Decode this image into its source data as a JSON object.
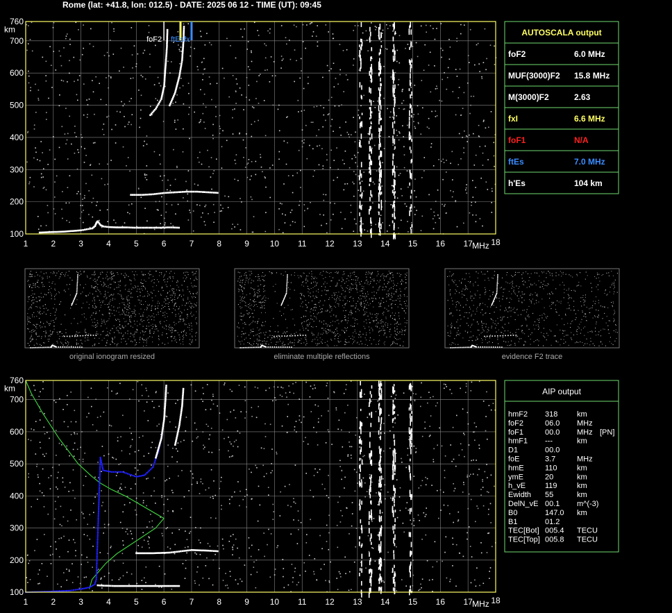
{
  "title": "Rome (lat: +41.8, lon: 012.5) - DATE: 2025 06 12 - TIME (UT): 09:45",
  "axes": {
    "y_unit": "km",
    "x_unit": "MHz",
    "y_ticks": [
      "760",
      "700",
      "600",
      "500",
      "400",
      "300",
      "200",
      "100"
    ],
    "x_ticks": [
      "1",
      "2",
      "3",
      "4",
      "5",
      "6",
      "7",
      "8",
      "9",
      "10",
      "11",
      "12",
      "13",
      "14",
      "15",
      "16",
      "17",
      "18"
    ]
  },
  "markers": {
    "foF2": "foF2",
    "ftEs_fx": "ftEsfx"
  },
  "colors": {
    "frame": "#ffff66",
    "grid": "#888888",
    "box": "#6fdc6f",
    "yellow": "#ffff66",
    "red": "#ff2020",
    "blue": "#3a8cff",
    "green": "#3ccc3c",
    "profile_blue": "#2020ff"
  },
  "autoscala": {
    "header": "AUTOSCALA output",
    "rows": [
      {
        "label": "foF2",
        "value": "6.0 MHz",
        "color": "#ffffff"
      },
      {
        "label": "MUF(3000)F2",
        "value": "15.8 MHz",
        "color": "#ffffff"
      },
      {
        "label": "M(3000)F2",
        "value": "2.63",
        "color": "#ffffff"
      },
      {
        "label": "fxI",
        "value": "6.6 MHz",
        "color": "#ffff66"
      },
      {
        "label": "foF1",
        "value": "N/A",
        "color": "#ff2020"
      },
      {
        "label": "ftEs",
        "value": "7.0 MHz",
        "color": "#3a8cff"
      },
      {
        "label": "h'Es",
        "value": "104    km",
        "color": "#ffffff"
      }
    ]
  },
  "thumbnails": [
    {
      "caption": "original ionogram resized"
    },
    {
      "caption": "eliminate multiple reflections"
    },
    {
      "caption": "evidence F2 trace"
    }
  ],
  "aip": {
    "header": "AIP output",
    "rows": [
      {
        "name": "hmF2",
        "value": "318",
        "unit": "km",
        "extra": ""
      },
      {
        "name": "foF2",
        "value": "06.0",
        "unit": "MHz",
        "extra": ""
      },
      {
        "name": "foF1",
        "value": "00.0",
        "unit": "MHz",
        "extra": "[PN]"
      },
      {
        "name": "hmF1",
        "value": "---",
        "unit": "km",
        "extra": ""
      },
      {
        "name": "D1",
        "value": "00.0",
        "unit": "",
        "extra": ""
      },
      {
        "name": "foE",
        "value": "3.7",
        "unit": "MHz",
        "extra": ""
      },
      {
        "name": "hmE",
        "value": "110",
        "unit": "km",
        "extra": ""
      },
      {
        "name": "ymE",
        "value": "20",
        "unit": "km",
        "extra": ""
      },
      {
        "name": "h_vE",
        "value": "119",
        "unit": "km",
        "extra": ""
      },
      {
        "name": "Ewidth",
        "value": "55",
        "unit": "km",
        "extra": ""
      },
      {
        "name": "DelN_vE",
        "value": "00.1",
        "unit": "m^(-3)",
        "extra": ""
      },
      {
        "name": "B0",
        "value": "147.0",
        "unit": "km",
        "extra": ""
      },
      {
        "name": "B1",
        "value": "01.2",
        "unit": "",
        "extra": ""
      },
      {
        "name": "TEC[Bot]",
        "value": "005.4",
        "unit": "TECU",
        "extra": ""
      },
      {
        "name": "TEC[Top]",
        "value": "005.8",
        "unit": "TECU",
        "extra": ""
      }
    ]
  },
  "chart_data": [
    {
      "type": "scatter",
      "name_ref": "ionogram-autoscala",
      "xlim": [
        1,
        18
      ],
      "ylim": [
        100,
        760
      ],
      "series": [
        {
          "kind": "E-trace",
          "x": [
            1.5,
            1.8,
            2.1,
            2.4,
            2.7,
            3.0,
            3.2,
            3.4,
            3.5,
            3.55,
            3.6,
            3.7,
            3.8,
            4.0,
            4.3,
            4.6,
            5.0,
            5.4,
            5.8,
            6.2,
            6.6
          ],
          "y": [
            105,
            106,
            107,
            108,
            110,
            112,
            115,
            118,
            125,
            135,
            140,
            128,
            124,
            122,
            121,
            121,
            120,
            120,
            120,
            121,
            120
          ]
        },
        {
          "kind": "F-bottom",
          "x": [
            4.8,
            5.2,
            5.6,
            6.0,
            6.4,
            6.8,
            7.2,
            7.6,
            8.0
          ],
          "y": [
            222,
            222,
            224,
            228,
            230,
            232,
            232,
            230,
            228
          ]
        },
        {
          "kind": "F2-trace",
          "x": [
            5.5,
            5.7,
            5.9,
            6.0,
            6.05,
            6.1,
            6.12
          ],
          "y": [
            470,
            490,
            520,
            560,
            620,
            680,
            740
          ]
        },
        {
          "kind": "F2x-trace",
          "x": [
            6.2,
            6.4,
            6.55,
            6.65,
            6.7,
            6.72
          ],
          "y": [
            500,
            540,
            590,
            640,
            700,
            750
          ]
        }
      ]
    },
    {
      "type": "line",
      "name_ref": "ionogram-aip",
      "xlim": [
        1,
        18
      ],
      "ylim": [
        100,
        760
      ],
      "series": [
        {
          "kind": "profile",
          "x": [
            1.0,
            1.2,
            1.6,
            2.2,
            2.9,
            3.4,
            3.7,
            4.1,
            4.6,
            5.2,
            5.7,
            6.0,
            5.7,
            5.0,
            4.3,
            3.9,
            3.6,
            3.4,
            3.3
          ],
          "y": [
            760,
            720,
            660,
            580,
            500,
            460,
            440,
            420,
            400,
            370,
            345,
            330,
            300,
            260,
            220,
            190,
            160,
            140,
            110
          ]
        },
        {
          "kind": "virtual-blue",
          "x": [
            1.0,
            1.8,
            2.6,
            3.0,
            3.3,
            3.5,
            3.55,
            3.7,
            3.8,
            4.1,
            4.5,
            5.0,
            5.3,
            5.6,
            5.8,
            5.95
          ],
          "y": [
            100,
            102,
            105,
            110,
            115,
            125,
            140,
            520,
            480,
            475,
            475,
            460,
            465,
            490,
            540,
            600
          ]
        },
        {
          "kind": "E-trace",
          "x": [
            3.6,
            3.8,
            4.2,
            4.8,
            5.4,
            6.0,
            6.6
          ],
          "y": [
            122,
            121,
            120,
            120,
            120,
            120,
            120
          ]
        },
        {
          "kind": "F-bottom",
          "x": [
            5.0,
            5.6,
            6.2,
            6.6,
            7.0,
            7.6,
            8.0
          ],
          "y": [
            222,
            222,
            224,
            228,
            232,
            230,
            228
          ]
        },
        {
          "kind": "F2-trace",
          "x": [
            5.7,
            5.9,
            6.0,
            6.05,
            6.08
          ],
          "y": [
            520,
            580,
            640,
            700,
            750
          ]
        },
        {
          "kind": "F2x-trace",
          "x": [
            6.4,
            6.55,
            6.65,
            6.7
          ],
          "y": [
            560,
            620,
            680,
            740
          ]
        }
      ]
    }
  ]
}
